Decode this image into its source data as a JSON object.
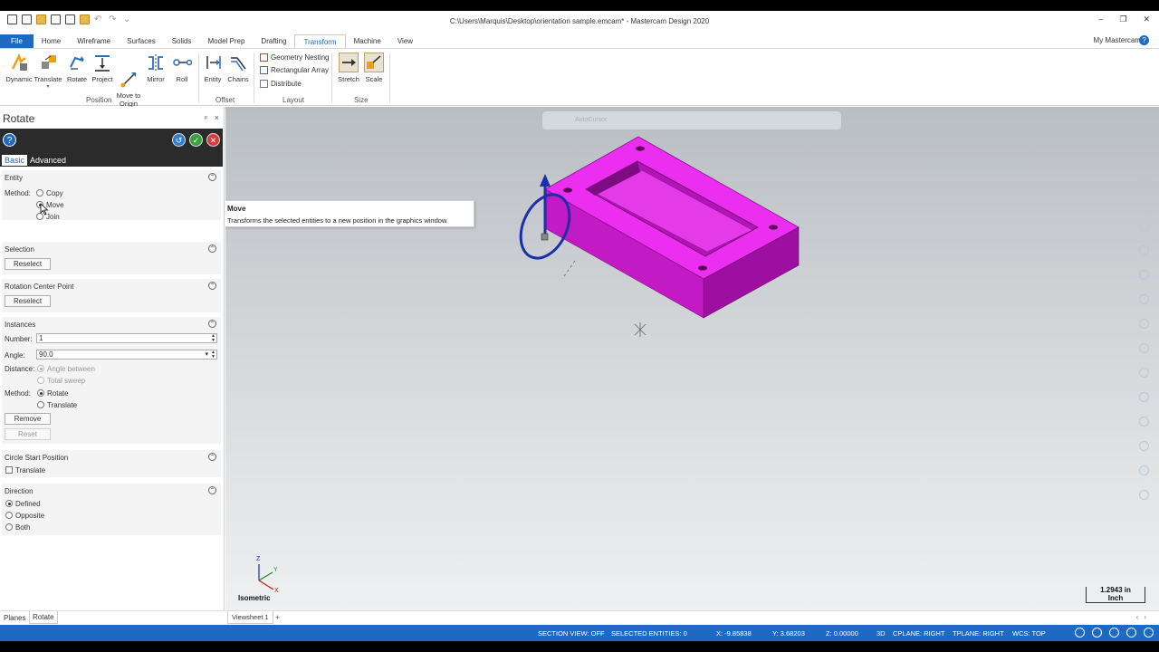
{
  "window": {
    "title": "C:\\Users\\Marquis\\Desktop\\orientation sample.emcam* - Mastercam Design 2020",
    "minimize": "–",
    "maximize": "❐",
    "close": "✕"
  },
  "ribbon_tabs": [
    "File",
    "Home",
    "Wireframe",
    "Surfaces",
    "Solids",
    "Model Prep",
    "Drafting",
    "Transform",
    "Machine",
    "View"
  ],
  "active_tab": "Transform",
  "my_mastercam": "My Mastercam",
  "ribbon": {
    "position_buttons": [
      {
        "label": "Dynamic",
        "icon": "dynamic-icon"
      },
      {
        "label": "Translate",
        "icon": "translate-icon"
      },
      {
        "label": "Rotate",
        "icon": "rotate-icon"
      },
      {
        "label": "Project",
        "icon": "project-icon"
      },
      {
        "label": "Move to\nOrigin",
        "icon": "move-to-origin-icon"
      },
      {
        "label": "Mirror",
        "icon": "mirror-icon"
      },
      {
        "label": "Roll",
        "icon": "roll-icon"
      }
    ],
    "position_group": "Position",
    "offset_buttons": [
      {
        "label": "Entity",
        "icon": "offset-entity-icon"
      },
      {
        "label": "Chains",
        "icon": "offset-chains-icon"
      }
    ],
    "offset_group": "Offset",
    "layout_items": [
      "Geometry Nesting",
      "Rectangular Array",
      "Distribute"
    ],
    "layout_group": "Layout",
    "size_buttons": [
      {
        "label": "Stretch",
        "icon": "stretch-icon"
      },
      {
        "label": "Scale",
        "icon": "scale-icon"
      }
    ],
    "size_group": "Size"
  },
  "panel": {
    "title": "Rotate",
    "pin": "ᵖ",
    "close": "×",
    "help": "?",
    "subtabs": {
      "basic": "Basic",
      "advanced": "Advanced"
    },
    "entity": {
      "heading": "Entity",
      "method_label": "Method:",
      "options": [
        "Copy",
        "Move",
        "Join"
      ],
      "selected": "Move"
    },
    "selection": {
      "heading": "Selection",
      "reselect": "Reselect"
    },
    "rotation_center": {
      "heading": "Rotation Center Point",
      "reselect": "Reselect"
    },
    "instances": {
      "heading": "Instances",
      "number_label": "Number:",
      "number_value": "1",
      "angle_label": "Angle:",
      "angle_value": "90.0",
      "distance_label": "Distance:",
      "distance_options": [
        "Angle between",
        "Total sweep"
      ],
      "method_label": "Method:",
      "method_options": [
        "Rotate",
        "Translate"
      ],
      "remove": "Remove",
      "reset": "Reset"
    },
    "circle_start": {
      "heading": "Circle Start Position",
      "translate": "Translate"
    },
    "direction": {
      "heading": "Direction",
      "options": [
        "Defined",
        "Opposite",
        "Both"
      ],
      "selected": "Defined"
    },
    "bottom_tabs": [
      "Planes",
      "Rotate"
    ]
  },
  "tooltip": {
    "title": "Move",
    "description": "Transforms the selected entities to a new position in the graphics window."
  },
  "viewport": {
    "autocursor": "AutoCursor",
    "view_name": "Isometric",
    "scale_value": "1.2943 in",
    "scale_unit": "Inch",
    "axes": {
      "z": "Z",
      "y": "Y",
      "x": "X"
    },
    "part_color": "#e01ee0"
  },
  "viewsheet": {
    "tab": "Viewsheet 1",
    "add": "+"
  },
  "status": {
    "section_view": "SECTION VIEW: OFF",
    "selected": "SELECTED ENTITIES: 0",
    "x": "X:   -9.85838",
    "y": "Y:   3.68203",
    "z": "Z:   0.00000",
    "mode": "3D",
    "cplane": "CPLANE: RIGHT",
    "tplane": "TPLANE: RIGHT",
    "wcs": "WCS: TOP"
  },
  "colors": {
    "accent": "#1e69c2",
    "panel_dark": "#2b2b2b",
    "part": "#e01ee0"
  }
}
